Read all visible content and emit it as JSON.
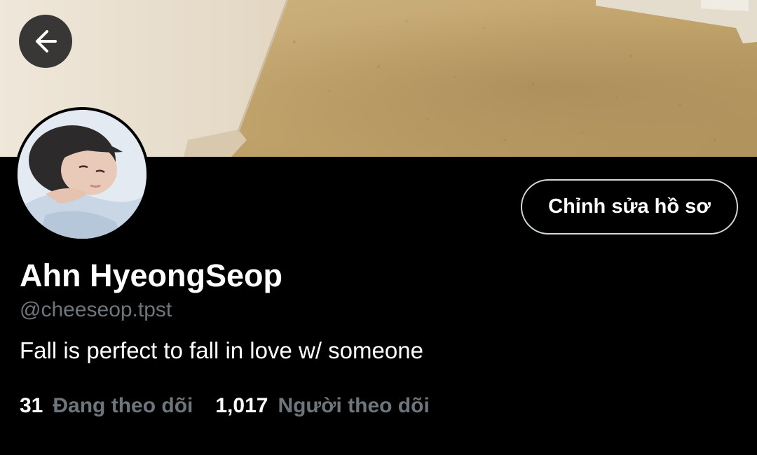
{
  "profile": {
    "display_name": "Ahn HyeongSeop",
    "username": "@cheeseop.tpst",
    "bio": "Fall is perfect to fall in love w/ someone",
    "edit_button_label": "Chỉnh sửa hồ sơ"
  },
  "stats": {
    "following_count": "31",
    "following_label": "Đang theo dõi",
    "followers_count": "1,017",
    "followers_label": "Người theo dõi"
  },
  "icons": {
    "back": "arrow-left-icon"
  },
  "colors": {
    "background": "#000000",
    "text_primary": "#ffffff",
    "text_secondary": "#6e767d",
    "button_border": "#cfd9de",
    "back_button_bg": "#282828"
  }
}
